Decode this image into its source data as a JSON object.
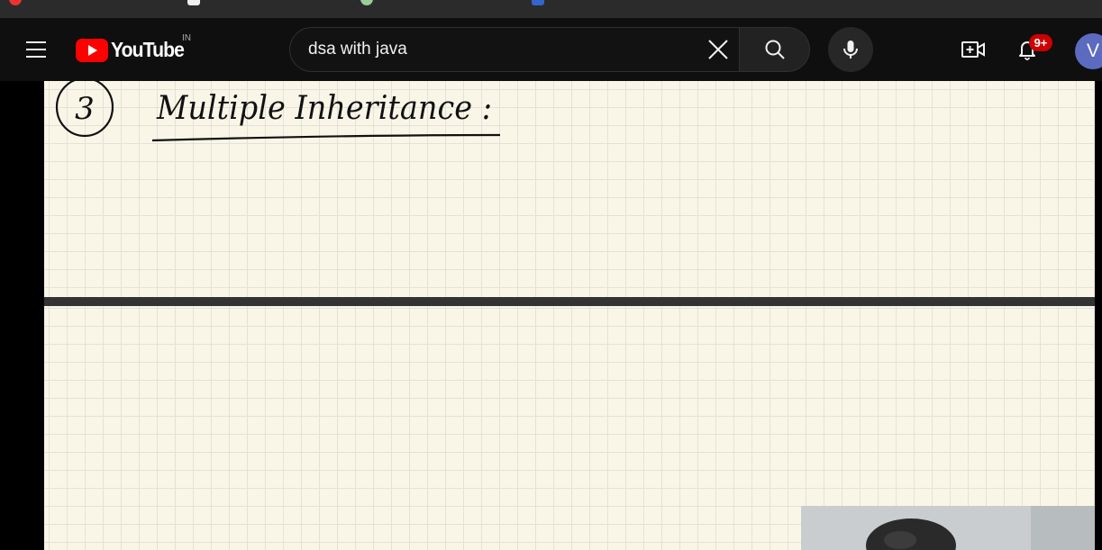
{
  "masthead": {
    "logo_text": "YouTube",
    "country_code": "IN",
    "search": {
      "query": "dsa with java"
    },
    "notification_count": "9+",
    "avatar_initial": "V"
  },
  "video": {
    "notes": {
      "heading_number": "3",
      "heading_text": "Multiple Inheritance :"
    }
  },
  "colors": {
    "masthead_bg": "#0f0f0f",
    "brand_red": "#ff0000",
    "badge_red": "#cc0000",
    "avatar_bg": "#5c6bc0",
    "paper": "#f9f6e8",
    "grid_line": "#e4e2d8",
    "ink": "#111111"
  },
  "icons": [
    "menu-icon",
    "youtube-play-icon",
    "clear-icon",
    "search-icon",
    "microphone-icon",
    "create-video-icon",
    "bell-icon"
  ]
}
